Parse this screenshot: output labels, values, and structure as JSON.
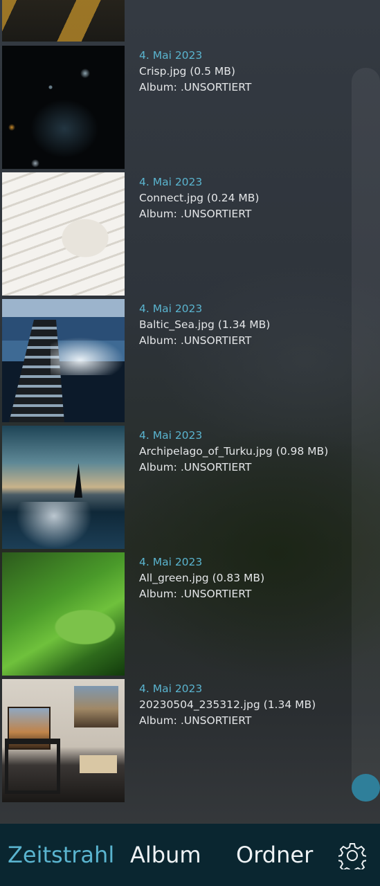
{
  "items": [
    {
      "date": "4. Mai 2023",
      "file": "Crisp.jpg (0.5 MB)",
      "album": "Album: .UNSORTIERT"
    },
    {
      "date": "4. Mai 2023",
      "file": "Connect.jpg (0.24 MB)",
      "album": "Album: .UNSORTIERT"
    },
    {
      "date": "4. Mai 2023",
      "file": "Baltic_Sea.jpg (1.34 MB)",
      "album": "Album: .UNSORTIERT"
    },
    {
      "date": "4. Mai 2023",
      "file": "Archipelago_of_Turku.jpg (0.98 MB)",
      "album": "Album: .UNSORTIERT"
    },
    {
      "date": "4. Mai 2023",
      "file": "All_green.jpg (0.83 MB)",
      "album": "Album: .UNSORTIERT"
    },
    {
      "date": "4. Mai 2023",
      "file": "20230504_235312.jpg (1.34 MB)",
      "album": "Album: .UNSORTIERT"
    }
  ],
  "nav": {
    "timeline": "Zeitstrahl",
    "album": "Album",
    "folder": "Ordner",
    "active": "timeline",
    "settings_icon": "gear-icon"
  },
  "colors": {
    "accent": "#5ab4cf",
    "nav_background": "#0a2630",
    "scroll_handle": "#2f7f9a"
  }
}
